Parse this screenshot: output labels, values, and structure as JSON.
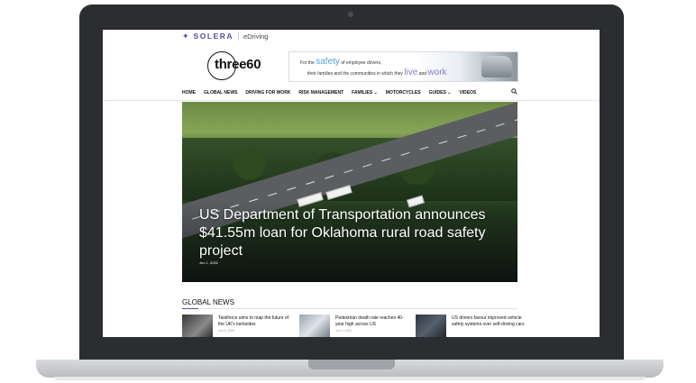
{
  "brand": {
    "company": "SOLERA",
    "product": "eDriving",
    "logo": "three60"
  },
  "banner": {
    "line1_pre": "For the",
    "line1_big": "safety",
    "line1_post": "of employee drivers,",
    "line2_pre": "their families and the communities in which they",
    "line2_big1": "live",
    "line2_mid": "and",
    "line2_big2": "work"
  },
  "nav": {
    "items": [
      "HOME",
      "GLOBAL NEWS",
      "DRIVING FOR WORK",
      "RISK MANAGEMENT",
      "FAMILIES ⌄",
      "MOTORCYCLES",
      "GUIDES ⌄",
      "VIDEOS"
    ],
    "search_icon": "search-icon"
  },
  "hero": {
    "title": "US Department of Transportation announces $41.55m loan for Oklahoma rural road safety project",
    "date": "Jun 1, 2022"
  },
  "section": {
    "title": "GLOBAL NEWS"
  },
  "cards": [
    {
      "title": "Taskforce aims to map the future of the UK's kerbsides",
      "date": "Jun 6, 2022"
    },
    {
      "title": "Pedestrian death rate reaches 40-year high across US",
      "date": "Jun 1, 2022"
    },
    {
      "title": "US drivers favour improved vehicle safety systems over self-driving cars",
      "date": ""
    }
  ],
  "colors": {
    "brand_purple": "#5b4aa6",
    "bezel": "#2b2d30"
  }
}
